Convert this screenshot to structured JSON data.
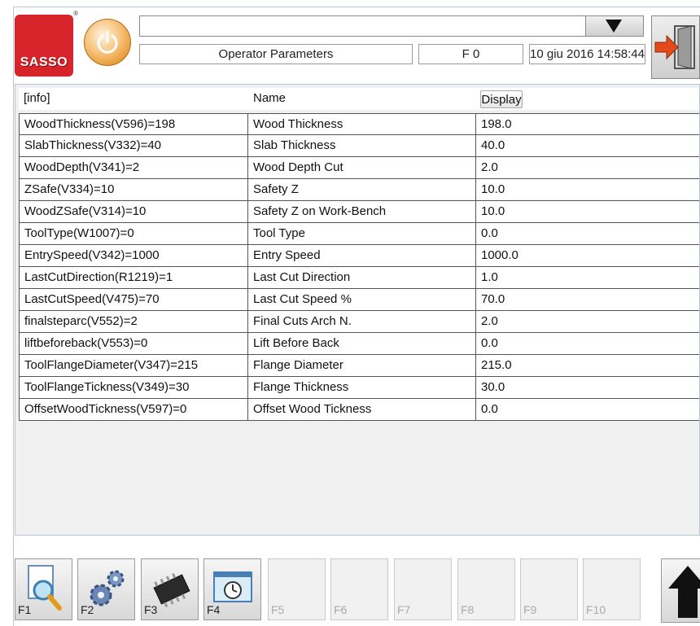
{
  "header": {
    "logo_text": "SASSO",
    "logo_mark": "®",
    "title": "Operator Parameters",
    "f_field": "F 0",
    "datetime": "10 giu 2016 14:58:44",
    "dropdown_value": ""
  },
  "table": {
    "columns": [
      "[info]",
      "Name",
      "Display"
    ],
    "rows": [
      {
        "info": "WoodThickness(V596)=198",
        "name": "Wood Thickness",
        "display": "198.0"
      },
      {
        "info": "SlabThickness(V332)=40",
        "name": "Slab Thickness",
        "display": "40.0"
      },
      {
        "info": "WoodDepth(V341)=2",
        "name": "Wood Depth Cut",
        "display": "2.0"
      },
      {
        "info": "ZSafe(V334)=10",
        "name": "Safety Z",
        "display": "10.0"
      },
      {
        "info": "WoodZSafe(V314)=10",
        "name": "Safety Z on Work-Bench",
        "display": "10.0"
      },
      {
        "info": "ToolType(W1007)=0",
        "name": "Tool Type",
        "display": "0.0"
      },
      {
        "info": "EntrySpeed(V342)=1000",
        "name": "Entry Speed",
        "display": "1000.0"
      },
      {
        "info": "LastCutDirection(R1219)=1",
        "name": "Last Cut Direction",
        "display": "1.0"
      },
      {
        "info": "LastCutSpeed(V475)=70",
        "name": "Last Cut Speed %",
        "display": "70.0"
      },
      {
        "info": "finalsteparc(V552)=2",
        "name": "Final Cuts Arch N.",
        "display": "2.0"
      },
      {
        "info": "liftbeforeback(V553)=0",
        "name": "Lift Before Back",
        "display": "0.0"
      },
      {
        "info": "ToolFlangeDiameter(V347)=215",
        "name": "Flange Diameter",
        "display": "215.0"
      },
      {
        "info": "ToolFlangeTickness(V349)=30",
        "name": "Flange Thickness",
        "display": "30.0"
      },
      {
        "info": "OffsetWoodTickness(V597)=0",
        "name": "Offset Wood Tickness",
        "display": "0.0"
      }
    ]
  },
  "function_keys": [
    {
      "label": "F1",
      "icon": "search-document-icon",
      "active": true
    },
    {
      "label": "F2",
      "icon": "gears-icon",
      "active": true
    },
    {
      "label": "F3",
      "icon": "chip-icon",
      "active": true
    },
    {
      "label": "F4",
      "icon": "clock-window-icon",
      "active": true
    },
    {
      "label": "F5",
      "icon": "",
      "active": false
    },
    {
      "label": "F6",
      "icon": "",
      "active": false
    },
    {
      "label": "F7",
      "icon": "",
      "active": false
    },
    {
      "label": "F8",
      "icon": "",
      "active": false
    },
    {
      "label": "F9",
      "icon": "",
      "active": false
    },
    {
      "label": "F10",
      "icon": "",
      "active": false
    }
  ],
  "colors": {
    "brand_red": "#d7242b",
    "power_orange": "#e6962e",
    "exit_arrow": "#e24a1a"
  }
}
